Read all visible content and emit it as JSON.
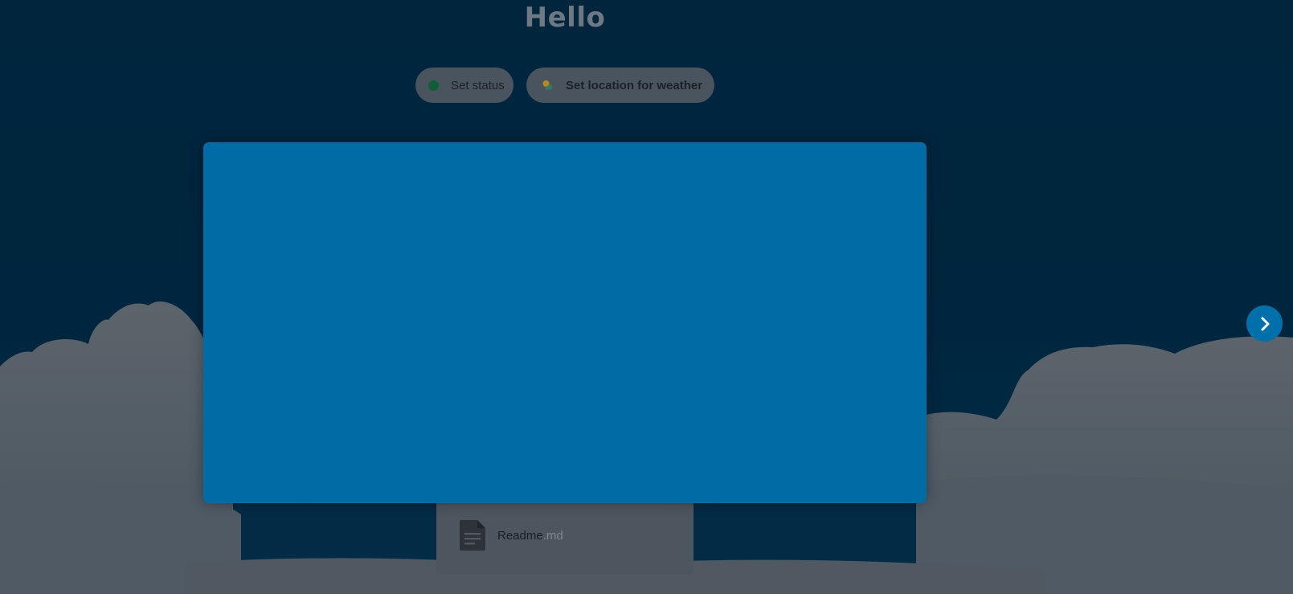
{
  "header": {
    "greeting": "Hello"
  },
  "quick_actions": {
    "status_label": "Set status",
    "weather_label": "Set location for weather",
    "status_dot_color": "#0e5f37"
  },
  "files": [
    {
      "name": "Readme",
      "extension": ".md",
      "icon": "document-icon"
    }
  ],
  "navigation": {
    "next_icon": "chevron-right-icon"
  },
  "colors": {
    "card_blue": "#006ca6",
    "background_navy": "#00253d",
    "next_button_blue": "#0070ab"
  }
}
